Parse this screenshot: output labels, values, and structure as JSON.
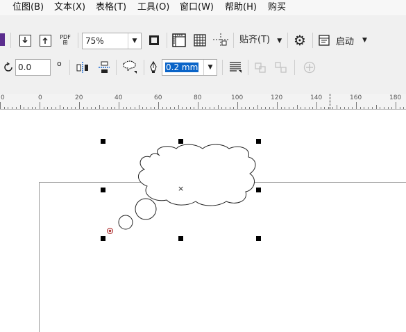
{
  "menu": [
    {
      "label": "位图(B)"
    },
    {
      "label": "文本(X)"
    },
    {
      "label": "表格(T)"
    },
    {
      "label": "工具(O)"
    },
    {
      "label": "窗口(W)"
    },
    {
      "label": "帮助(H)"
    },
    {
      "label": "购买"
    }
  ],
  "toolbar1": {
    "pdf_label": "PDF",
    "zoom_value": "75%",
    "snap_label": "贴齐(T)",
    "launch_label": "启动",
    "dropdown_arrow": "▼"
  },
  "toolbar2": {
    "rotation_value": "0.0",
    "degree_symbol": "o",
    "outline_value": "0.2 mm",
    "dropdown_arrow": "▼"
  },
  "ruler": {
    "labels": [
      "0",
      "0",
      "20",
      "40",
      "60",
      "80",
      "100",
      "120",
      "140",
      "160",
      "180"
    ]
  },
  "canvas": {
    "center_marker": "×"
  },
  "colors": {
    "accent": "#5b2d8e",
    "selection": "#0a64c8",
    "node_marker": "#a31515"
  },
  "icons": [
    "import-icon",
    "export-icon",
    "publish-pdf-icon",
    "full-screen-icon",
    "show-rulers-icon",
    "show-grid-icon",
    "show-guidelines-icon",
    "gear-icon",
    "launch-icon",
    "rotate-icon",
    "mirror-horizontal-icon",
    "mirror-vertical-icon",
    "outline-icon",
    "pen-icon",
    "wrap-text-icon",
    "combine-icon",
    "break-apart-icon",
    "add-icon"
  ]
}
